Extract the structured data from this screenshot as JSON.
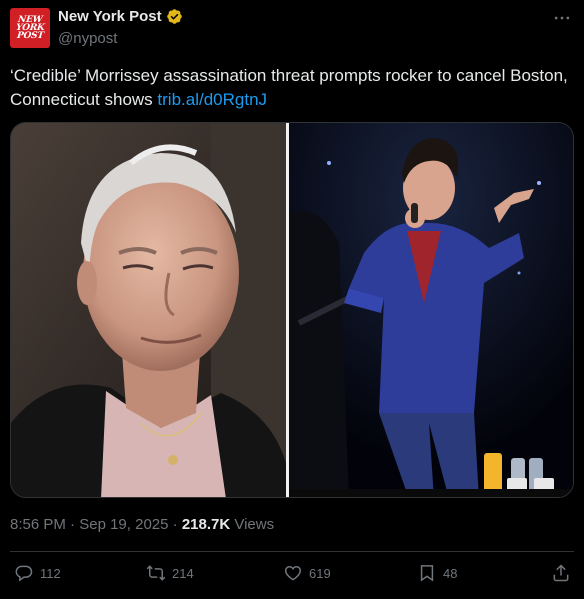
{
  "author": {
    "name": "New York Post",
    "handle": "@nypost",
    "avatar_lines": [
      "NEW",
      "YORK",
      "POST"
    ],
    "verified": true
  },
  "more_icon": "more-horizontal-icon",
  "tweet": {
    "text": "‘Credible’ Morrissey assassination threat prompts rocker to cancel Boston, Connecticut shows ",
    "link": "trib.al/d0RgtnJ"
  },
  "media": {
    "left_image": "portrait-photo",
    "right_image": "concert-photo"
  },
  "meta": {
    "time": "8:56 PM",
    "dot1": " · ",
    "date": "Sep 19, 2025",
    "dot2": " · ",
    "views_count": "218.7K",
    "views_label": " Views"
  },
  "actions": {
    "replies": "112",
    "reposts": "214",
    "likes": "619",
    "bookmarks": "48"
  },
  "colors": {
    "background": "#000000",
    "text": "#e7e9ea",
    "muted": "#71767b",
    "link": "#1d9bf0",
    "verified_gold": "#e2b719",
    "brand_red": "#d11f26"
  }
}
